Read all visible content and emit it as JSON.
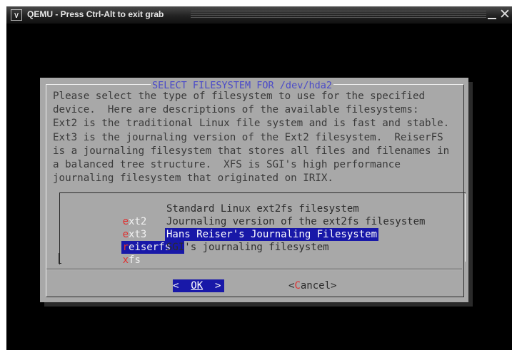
{
  "window": {
    "title": "QEMU - Press Ctrl-Alt to exit grab"
  },
  "dialog": {
    "title": "SELECT FILESYSTEM FOR /dev/hda2",
    "description": [
      "Please select the type of filesystem to use for the specified",
      "device.  Here are descriptions of the available filesystems:",
      "Ext2 is the traditional Linux file system and is fast and stable.",
      "Ext3 is the journaling version of the Ext2 filesystem.  ReiserFS",
      "is a journaling filesystem that stores all files and filenames in",
      "a balanced tree structure.  XFS is SGI's high performance",
      "journaling filesystem that originated on IRIX."
    ],
    "options": [
      {
        "hotkey": "e",
        "rest": "xt2",
        "description": "Standard Linux ext2fs filesystem",
        "selected": false
      },
      {
        "hotkey": "e",
        "rest": "xt3",
        "description": "Journaling version of the ext2fs filesystem",
        "selected": false
      },
      {
        "hotkey": "r",
        "rest": "eiserfs",
        "description": "Hans Reiser's Journaling Filesystem",
        "selected": true
      },
      {
        "hotkey": "x",
        "rest": "fs",
        "description": "SGI's journaling filesystem",
        "selected": false
      }
    ],
    "buttons": {
      "ok_left": "<  ",
      "ok_label": "OK",
      "ok_right": "  >",
      "cancel_left": "<",
      "cancel_hot": "C",
      "cancel_rest": "ancel>"
    }
  },
  "colors": {
    "dialog_bg": "#a8a8a8",
    "title": "#4a4ac8",
    "highlight": "#1818a8",
    "hotkey": "#e03030"
  },
  "icons": [
    "window-menu-icon",
    "minimize-icon",
    "close-icon"
  ]
}
